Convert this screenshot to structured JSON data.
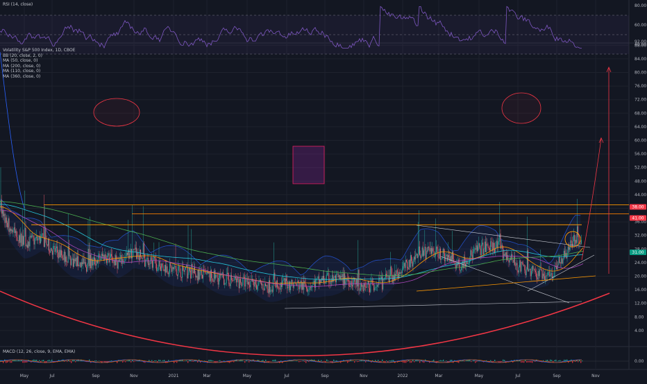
{
  "panes": {
    "rsi": {
      "title": "RSI (14, close)",
      "ticks": [
        "80.00",
        "60.00",
        "40.00"
      ],
      "hidden_tick": "92.00"
    },
    "main": {
      "legend": [
        "Volatility S&P 500 Index, 1D, CBOE",
        "BB (20, close, 2, 0)",
        "MA (50, close, 0)",
        "MA (200, close, 0)",
        "MA (110, close, 0)",
        "MA (360, close, 0)"
      ],
      "price_ticks": [
        "88.00",
        "84.00",
        "80.00",
        "76.00",
        "72.00",
        "68.00",
        "64.00",
        "60.00",
        "56.00",
        "52.00",
        "48.00",
        "44.00",
        "40.00",
        "36.00",
        "32.00",
        "28.00",
        "24.00",
        "20.00",
        "16.00",
        "12.00",
        "8.00",
        "4.00"
      ],
      "badges": [
        {
          "label": "38.00",
          "color": "#f23645"
        },
        {
          "label": "41.00",
          "color": "#f23645"
        },
        {
          "label": "31.00",
          "color": "#089981"
        }
      ]
    },
    "macd": {
      "title": "MACD (12, 26, close, 9, EMA, EMA)",
      "ticks": [
        "0.00"
      ]
    }
  },
  "time_axis": [
    "May",
    "Jul",
    "Sep",
    "Nov",
    "2021",
    "Mar",
    "May",
    "Jul",
    "Sep",
    "Nov",
    "2022",
    "Mar",
    "May",
    "Jul",
    "Sep",
    "Nov"
  ],
  "colors": {
    "background": "#131722",
    "grid": "#1e222d",
    "price_line": "#e45b6b",
    "bands": "#2962ff",
    "resistance": "#ff9800",
    "arc": "#f23645",
    "rsi": "#7e57c2"
  },
  "chart_data": {
    "type": "candlestick",
    "symbol": "Volatility S&P 500 Index",
    "interval": "1D",
    "x": [
      "2020-05",
      "2020-07",
      "2020-09",
      "2020-11",
      "2021-01",
      "2021-03",
      "2021-05",
      "2021-07",
      "2021-09",
      "2021-11",
      "2022-01",
      "2022-03",
      "2022-05",
      "2022-07",
      "2022-09",
      "2022-11"
    ],
    "close_approx": [
      34,
      29,
      26,
      25,
      23,
      21,
      18,
      17,
      19,
      18,
      22,
      27,
      28,
      23,
      31,
      null
    ],
    "ylim": [
      0,
      92
    ],
    "horizontal_levels": [
      41,
      38
    ],
    "projection_target": 64,
    "arrow_target": 85,
    "rsi_ylim": [
      35,
      92
    ],
    "rsi_levels": [
      70,
      50,
      30
    ],
    "annotations": [
      "ellipse",
      "ellipse",
      "rectangle",
      "circle",
      "arrow",
      "curve",
      "trendlines",
      "arc"
    ]
  }
}
